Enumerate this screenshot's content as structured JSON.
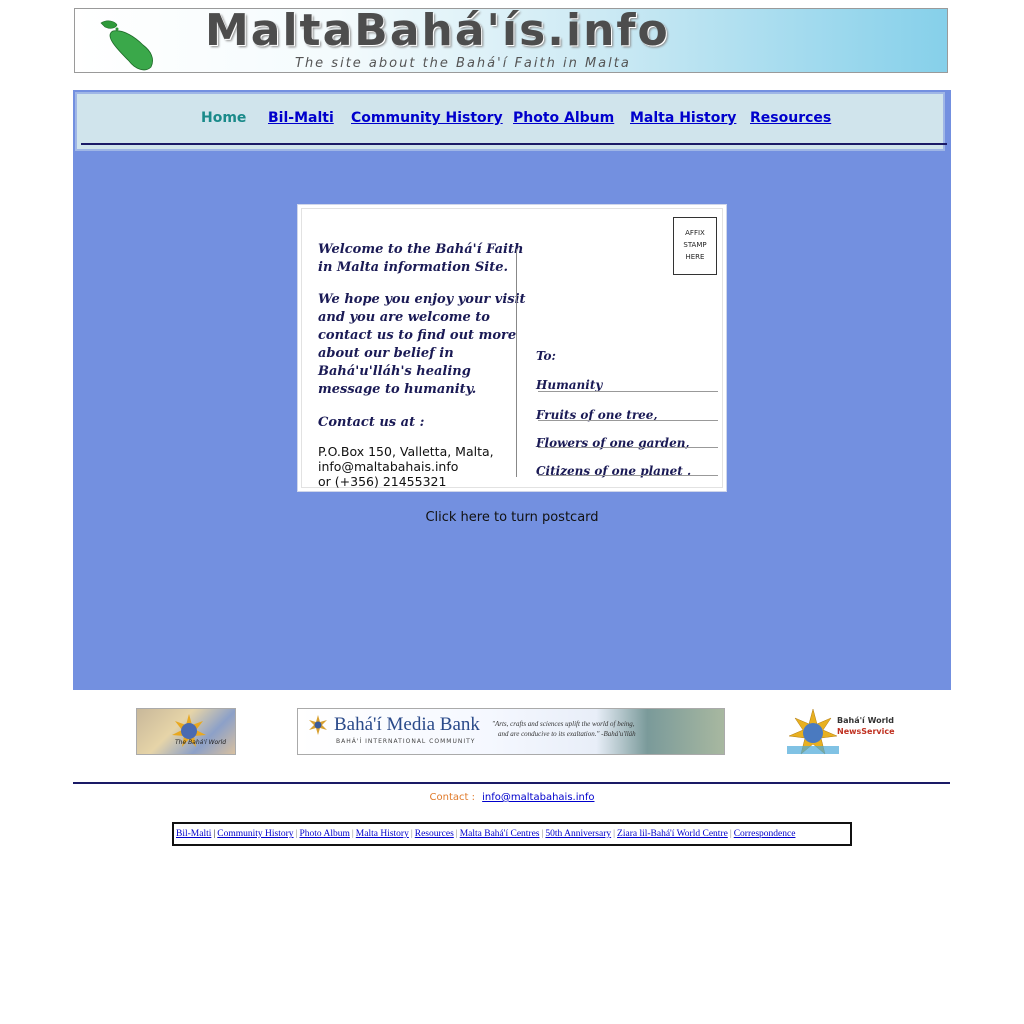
{
  "header": {
    "title": "MaltaBahá'ís.info",
    "subtitle": "The site about the Bahá'í Faith in Malta"
  },
  "nav": {
    "items": [
      {
        "label": "Home",
        "current": true
      },
      {
        "label": "Bil-Malti"
      },
      {
        "label": "Community History"
      },
      {
        "label": "Photo Album"
      },
      {
        "label": "Malta History"
      },
      {
        "label": "Resources"
      }
    ]
  },
  "postcard": {
    "welcome_1": "Welcome to the Bahá'í Faith",
    "welcome_2": "in Malta information Site.",
    "hope_1": "We hope you enjoy your visit",
    "hope_2": "and you are welcome to",
    "hope_3": "contact us to find out more",
    "hope_4": "about our belief in",
    "hope_5": "Bahá'u'lláh's healing",
    "hope_6": "message to humanity.",
    "contact_heading": "Contact us at :",
    "address_1": "P.O.Box 150, Valletta, Malta,",
    "address_2": "info@maltabahais.info",
    "address_3": "or (+356) 21455321",
    "stamp_1": "AFFIX",
    "stamp_2": "STAMP",
    "stamp_3": "HERE",
    "to_label": "To:",
    "addr_1": "Humanity",
    "addr_2": "Fruits of one tree,",
    "addr_3": "Flowers of one garden,",
    "addr_4": "Citizens of one planet ."
  },
  "turn_link": "Click here to turn postcard",
  "logos": {
    "bahai_world_text": "The Bahá'í World",
    "media_bank_title": "Bahá'í Media Bank",
    "media_bank_sub": "BAHÁ'Í INTERNATIONAL COMMUNITY",
    "media_bank_quote_1": "\"Arts, crafts and sciences uplift the world of being,",
    "media_bank_quote_2": "and are conducive to its exaltation.\" -Bahá'u'lláh",
    "news_1": "Bahá'í World",
    "news_2": "NewsService"
  },
  "footer": {
    "contact_label": "Contact :",
    "contact_email": "info@maltabahais.info",
    "links": [
      "Bil-Malti",
      "Community History",
      "Photo Album",
      "Malta History",
      "Resources",
      "Malta Bahá'í Centres",
      "50th Anniversary",
      "Ziara lil-Bahá'í World Centre",
      "Correspondence"
    ]
  },
  "colors": {
    "panel": "#7390e0",
    "nav_bg": "#d0e4ec",
    "link": "#0000cc",
    "current": "#1a8a8a",
    "contact_label": "#e07a2a"
  }
}
